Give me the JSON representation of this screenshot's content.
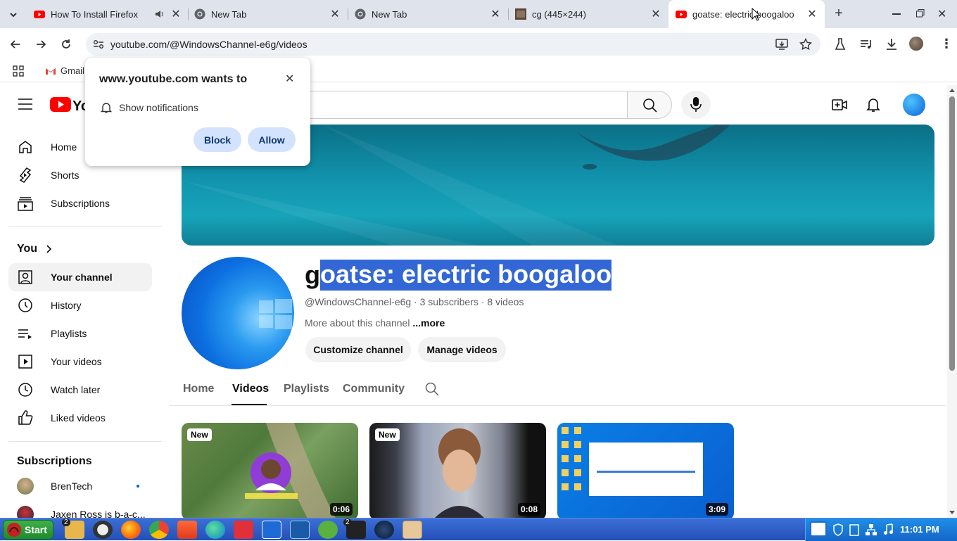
{
  "browser": {
    "tabs": [
      {
        "title": "How To Install Firefox",
        "favicon": "youtube-icon",
        "audio": true
      },
      {
        "title": "New Tab",
        "favicon": "chrome-icon"
      },
      {
        "title": "New Tab",
        "favicon": "chrome-icon"
      },
      {
        "title": "cg (445×244)",
        "favicon": "image-icon"
      },
      {
        "title": "goatse: electric boogaloo",
        "favicon": "youtube-icon",
        "active": true
      }
    ],
    "url": "youtube.com/@WindowsChannel-e6g/videos",
    "bookmarks": [
      {
        "label": "Gmail"
      }
    ]
  },
  "permission_popup": {
    "title": "www.youtube.com wants to",
    "item": "Show notifications",
    "block_label": "Block",
    "allow_label": "Allow"
  },
  "sidebar": {
    "main": [
      {
        "label": "Home",
        "icon": "home-icon"
      },
      {
        "label": "Shorts",
        "icon": "shorts-icon"
      },
      {
        "label": "Subscriptions",
        "icon": "subscriptions-icon"
      }
    ],
    "you_label": "You",
    "you": [
      {
        "label": "Your channel",
        "icon": "your-channel-icon",
        "selected": true
      },
      {
        "label": "History",
        "icon": "history-icon"
      },
      {
        "label": "Playlists",
        "icon": "playlists-icon"
      },
      {
        "label": "Your videos",
        "icon": "your-videos-icon"
      },
      {
        "label": "Watch later",
        "icon": "watch-later-icon"
      },
      {
        "label": "Liked videos",
        "icon": "liked-videos-icon"
      }
    ],
    "subscriptions_label": "Subscriptions",
    "subscriptions": [
      {
        "label": "BrenTech",
        "new_dot": true
      },
      {
        "label": "Jaxen Ross is b-a-c..."
      }
    ]
  },
  "channel": {
    "name_first": "g",
    "name_rest": "oatse: electric boogaloo",
    "meta": "@WindowsChannel-e6g · 3 subscribers · 8 videos",
    "about": "More about this channel",
    "more": "...more",
    "customize_label": "Customize channel",
    "manage_label": "Manage videos",
    "tabs": [
      "Home",
      "Videos",
      "Playlists",
      "Community"
    ],
    "active_tab": "Videos"
  },
  "videos": [
    {
      "badge": "New",
      "duration": "0:06"
    },
    {
      "badge": "New",
      "duration": "0:08"
    },
    {
      "badge": "",
      "duration": "3:09"
    }
  ],
  "taskbar": {
    "start_label": "Start",
    "clock": "11:01 PM",
    "badges": [
      "2",
      "2"
    ]
  },
  "colors": {
    "youtube_red": "#ff0000",
    "selection": "#3367d6",
    "taskbar": "#2a5bc4",
    "chrome_tabbar": "#dfe3ec"
  }
}
